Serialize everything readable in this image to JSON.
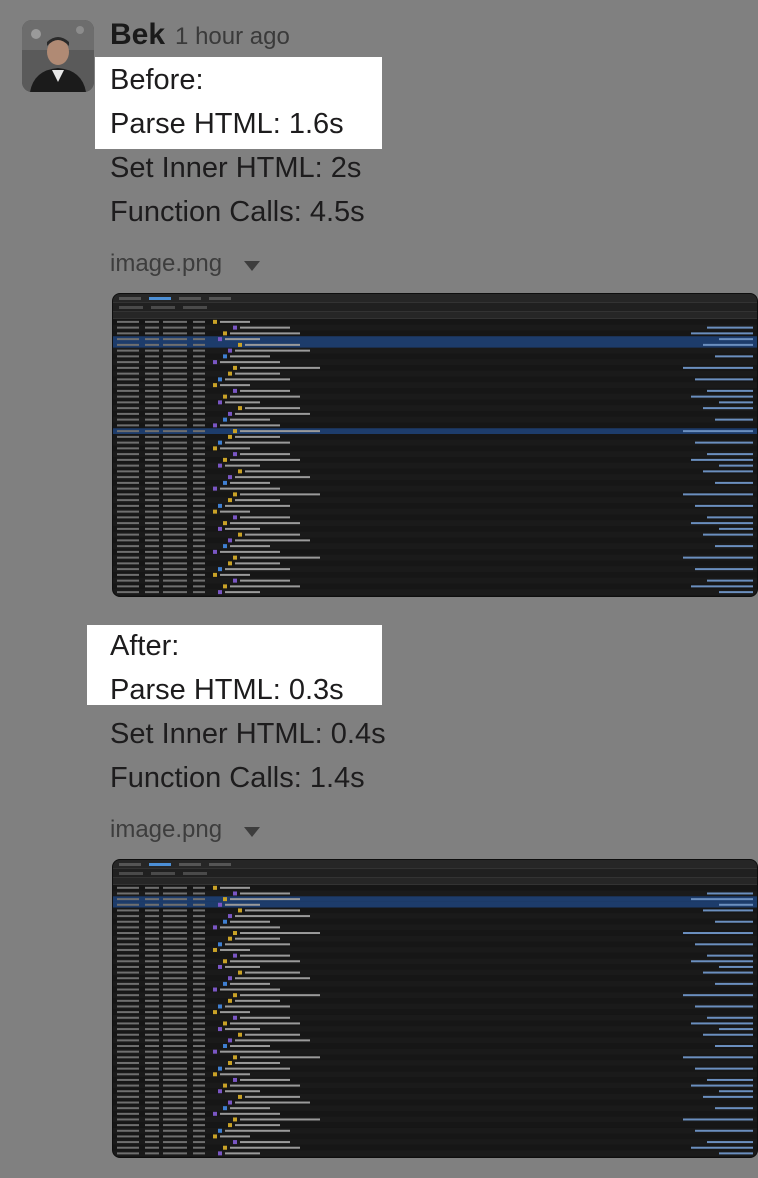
{
  "message": {
    "author": "Bek",
    "timestamp": "1 hour ago",
    "before": {
      "heading": "Before:",
      "lines": [
        "Parse HTML: 1.6s",
        "Set Inner HTML: 2s",
        "Function Calls: 4.5s"
      ],
      "attachment": {
        "filename": "image.png",
        "toggle_icon": "caret-down-icon"
      }
    },
    "after": {
      "heading": "After:",
      "lines": [
        "Parse HTML: 0.3s",
        "Set Inner HTML: 0.4s",
        "Function Calls: 1.4s"
      ],
      "attachment": {
        "filename": "image.png",
        "toggle_icon": "caret-down-icon"
      }
    }
  },
  "colors": {
    "background": "#808080",
    "highlight": "#ffffff",
    "devtools_bg": "#161616",
    "selection": "#1d3c6b"
  }
}
